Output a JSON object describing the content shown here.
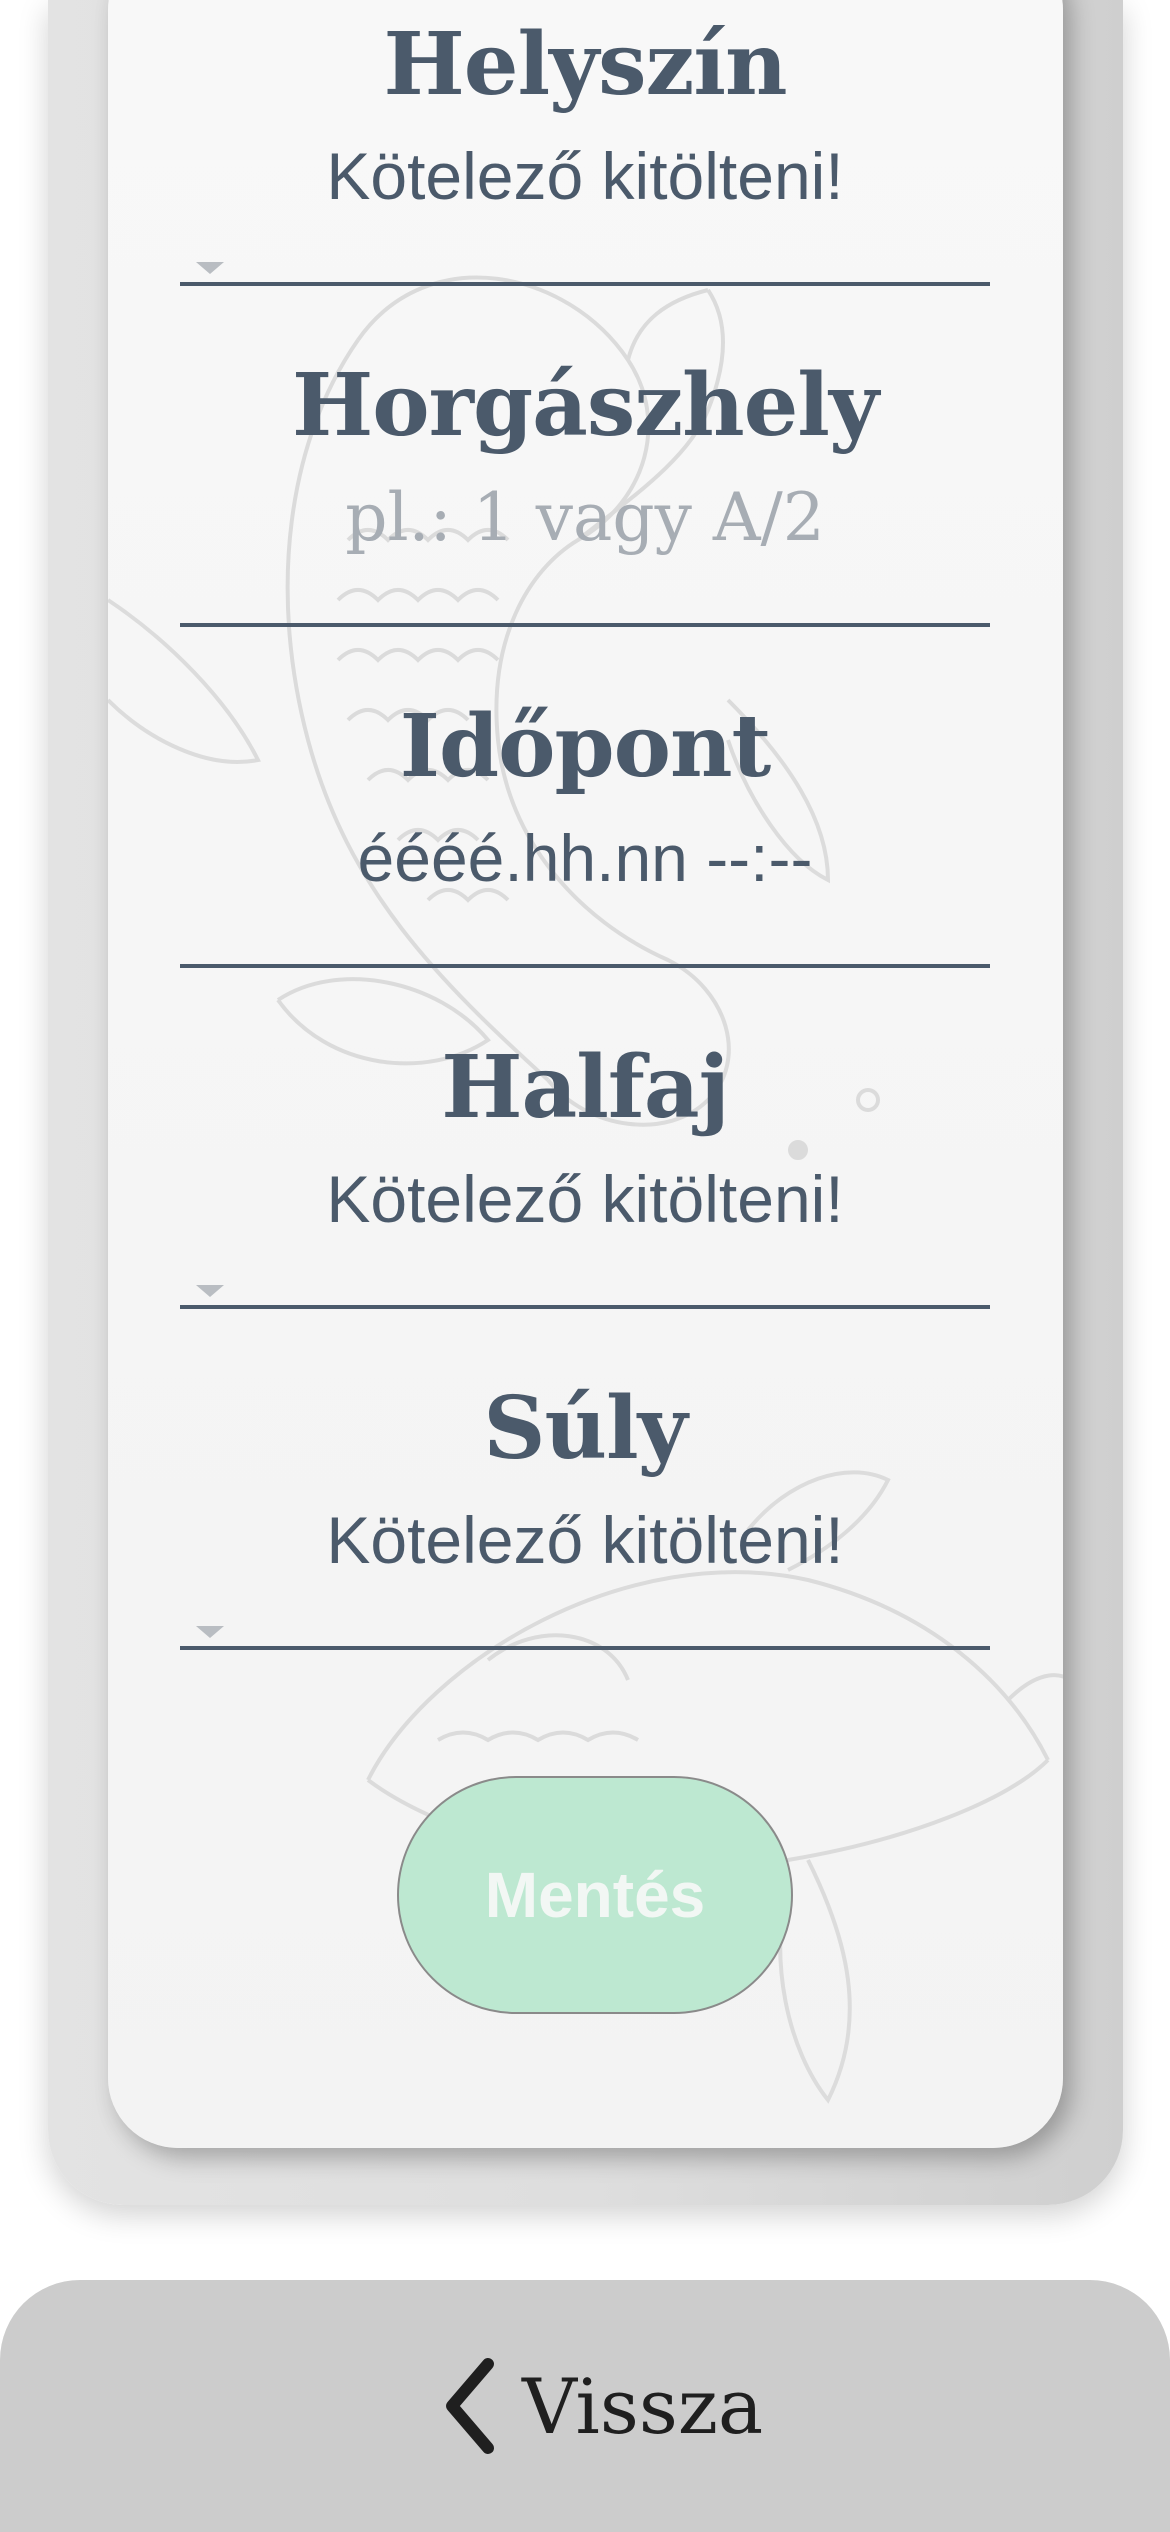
{
  "form": {
    "fields": [
      {
        "label": "Helyszín",
        "value": "Kötelező kitölteni!",
        "type": "select"
      },
      {
        "label": "Horgászhely",
        "placeholder": "pl.: 1 vagy A/2",
        "type": "text"
      },
      {
        "label": "Időpont",
        "value": "éééé.hh.nn --:--",
        "type": "datetime"
      },
      {
        "label": "Halfaj",
        "value": "Kötelező kitölteni!",
        "type": "select"
      },
      {
        "label": "Súly",
        "value": "Kötelező kitölteni!",
        "type": "select"
      }
    ],
    "save_label": "Mentés"
  },
  "nav": {
    "back_label": "Vissza"
  },
  "colors": {
    "text": "#4b5a6b",
    "placeholder": "#a7adb4",
    "save_bg": "#bde8d1",
    "bottom_bar": "#cccccc"
  },
  "icons": {
    "back": "chevron-left-icon",
    "caret": "caret-down-icon"
  }
}
